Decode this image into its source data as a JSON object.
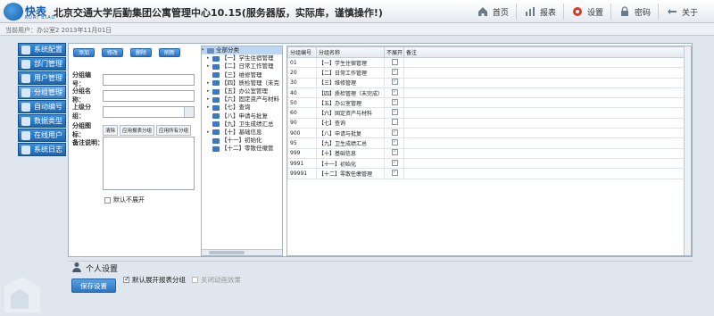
{
  "header": {
    "logo_text": "快表",
    "logo_sub": "KUAI BIAO",
    "title": "北京交通大学后勤集团公寓管理中心10.15(服务器版，实际库，谨慎操作!)",
    "nav": [
      {
        "label": "首页",
        "icon": "home-icon"
      },
      {
        "label": "报表",
        "icon": "report-icon"
      },
      {
        "label": "设置",
        "icon": "gear-icon"
      },
      {
        "label": "密码",
        "icon": "lock-icon"
      },
      {
        "label": "关于",
        "icon": "about-icon"
      }
    ]
  },
  "subbar": {
    "user": "当前用户：办公室2 2013年11月01日"
  },
  "sidenav": [
    {
      "label": "系统配置",
      "icon": "config-icon"
    },
    {
      "label": "部门管理",
      "icon": "department-icon"
    },
    {
      "label": "用户管理",
      "icon": "user-icon"
    },
    {
      "label": "分组管理",
      "icon": "group-icon"
    },
    {
      "label": "自动编号",
      "icon": "autonumber-icon"
    },
    {
      "label": "数据类型",
      "icon": "datatype-icon"
    },
    {
      "label": "在线用户",
      "icon": "online-user-icon"
    },
    {
      "label": "系统日志",
      "icon": "log-icon"
    }
  ],
  "toolbar": {
    "add": "添加",
    "edit": "修改",
    "delete": "删除",
    "refresh": "刷新"
  },
  "form": {
    "code_label": "分组编号：",
    "name_label": "分组名称：",
    "parent_label": "上级分组：",
    "icon_label": "分组图标：",
    "icon_clear": "清除",
    "icon_apply_report": "应用报表分组",
    "icon_apply_all": "应用所有分组",
    "memo_label": "备注说明：",
    "no_expand_label": "默认不展开"
  },
  "tree": {
    "root": "全部分类",
    "items": [
      "【一】学生住宿管理",
      "【二】日常工作管理",
      "【三】维修管理",
      "【四】质检管理（未完",
      "【五】办公室管理",
      "【六】固定资产与材料",
      "【七】查询",
      "【八】申请与批复",
      "【九】卫生成绩汇总",
      "【十】基础信息",
      "【十一】初始化",
      "【十二】零散任缴管"
    ]
  },
  "table": {
    "headers": [
      "分组编号",
      "分组名称",
      "不展开",
      "备注"
    ],
    "rows": [
      {
        "code": "01",
        "name": "【一】学生住宿管理",
        "noexpand": false
      },
      {
        "code": "20",
        "name": "【二】日常工作管理",
        "noexpand": true
      },
      {
        "code": "30",
        "name": "【三】维修管理",
        "noexpand": true
      },
      {
        "code": "40",
        "name": "【四】质检管理（未完成）",
        "noexpand": true
      },
      {
        "code": "50",
        "name": "【五】办公室管理",
        "noexpand": true
      },
      {
        "code": "60",
        "name": "【六】固定资产与材料",
        "noexpand": true
      },
      {
        "code": "90",
        "name": "【七】查询",
        "noexpand": false
      },
      {
        "code": "900",
        "name": "【八】申请与批复",
        "noexpand": true
      },
      {
        "code": "95",
        "name": "【九】卫生成绩汇总",
        "noexpand": true
      },
      {
        "code": "999",
        "name": "【十】基础信息",
        "noexpand": true
      },
      {
        "code": "9991",
        "name": "【十一】初始化",
        "noexpand": true
      },
      {
        "code": "99991",
        "name": "【十二】零散任缴管理",
        "noexpand": true
      }
    ]
  },
  "personal": {
    "title": "个人设置",
    "expand_report_group": "默认展开报表分组",
    "close_animation": "关闭动画效果",
    "save": "保存设置"
  },
  "colors": {
    "accent": "#1e63b0",
    "gear_active": "#d63b2a"
  }
}
